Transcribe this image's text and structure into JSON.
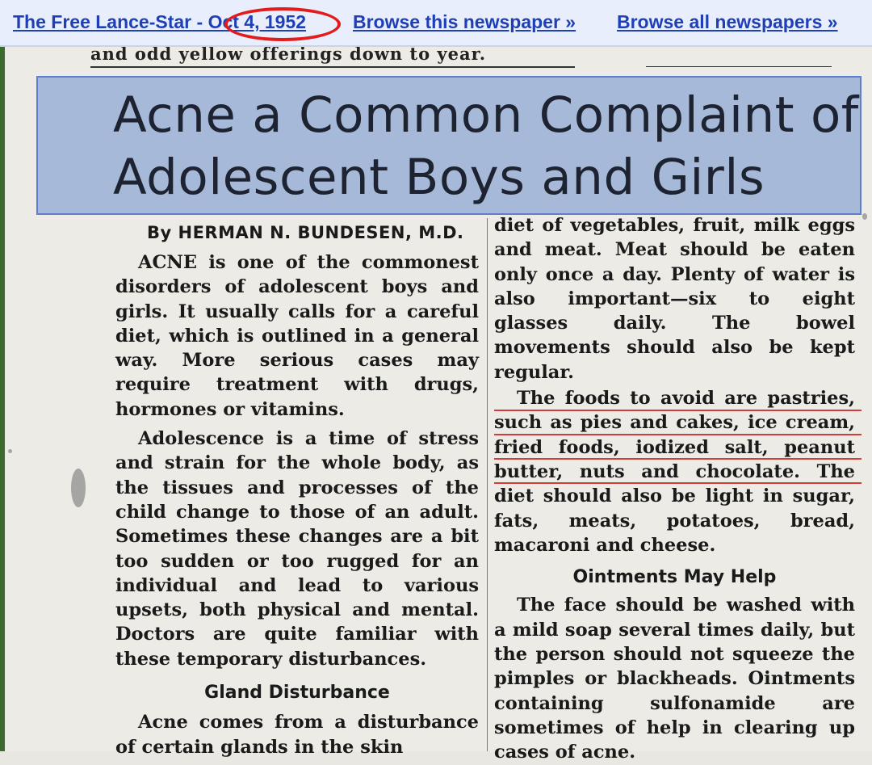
{
  "topbar": {
    "publication_date_link": "The Free Lance-Star - Oct 4, 1952",
    "browse_this": "Browse this newspaper »",
    "browse_all": "Browse all newspapers »"
  },
  "article": {
    "preceding_line": "and odd yellow offerings down to year.",
    "headline_line1": "Acne a Common Complaint of",
    "headline_line2": "Adolescent Boys and Girls",
    "byline": "By HERMAN N. BUNDESEN, M.D.",
    "left_paragraphs": [
      "ACNE is one of the commonest disorders of adolescent boys and girls. It usually calls for a careful diet, which is outlined in a general way. More serious cases may require treatment with drugs, hormones or vitamins.",
      "Adolescence is a time of stress and strain for the whole body, as the tissues and processes of the child change to those of an adult. Sometimes these changes are a bit too sudden or too rugged for an individual and lead to various upsets, both physical and mental. Doctors are quite familiar with these temporary disturbances."
    ],
    "subhead_gland": "Gland Disturbance",
    "left_tail": "Acne comes from a disturbance of certain glands in the skin",
    "right_paragraph1": "diet of vegetables, fruit, milk eggs and meat. Meat should be eaten only once a day. Plenty of water is also important—six to eight glasses daily. The bowel movements should also be kept regular.",
    "right_paragraph2": "The foods to avoid are pastries, such as pies and cakes, ice cream, fried foods, iodized salt, peanut butter, nuts and chocolate. The diet should also be light in sugar, fats, meats, potatoes, bread, macaroni and cheese.",
    "subhead_ointments": "Ointments May Help",
    "right_paragraph3": "The face should be washed with a mild soap several times daily, but the person should not squeeze the pimples or blackheads. Ointments containing sulfonamide are sometimes of help in clearing up cases of acne."
  },
  "colors": {
    "link": "#1f3fb8",
    "highlight": "#8ca5d4",
    "circle_annotation": "#e31b1b",
    "underline_annotation": "#d43b3b"
  }
}
